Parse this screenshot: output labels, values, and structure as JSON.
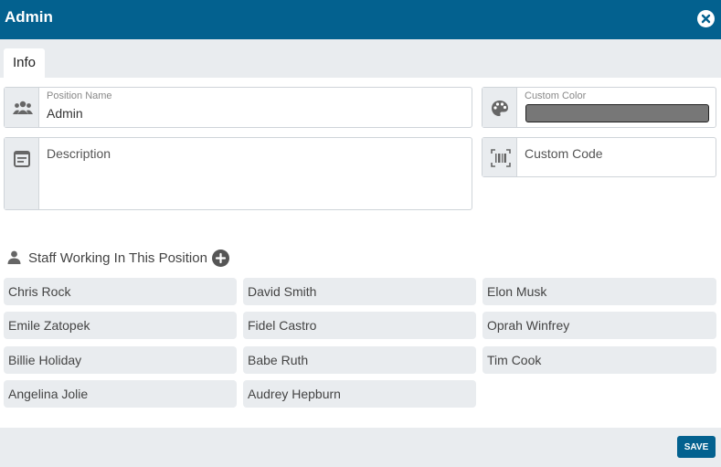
{
  "window": {
    "title": "Admin",
    "close_icon": "close-circle-icon"
  },
  "tabs": [
    {
      "label": "Info",
      "active": true
    }
  ],
  "form": {
    "position_name": {
      "label": "Position Name",
      "value": "Admin",
      "icon": "group-icon"
    },
    "custom_color": {
      "label": "Custom Color",
      "value_color": "#777777",
      "icon": "palette-icon"
    },
    "description": {
      "label": "Description",
      "value": "",
      "icon": "notes-icon"
    },
    "custom_code": {
      "label": "Custom Code",
      "value": "",
      "icon": "barcode-icon"
    }
  },
  "staff": {
    "heading": "Staff Working In This Position",
    "members": [
      "Chris Rock",
      "David Smith",
      "Elon Musk",
      "Emile Zatopek",
      "Fidel Castro",
      "Oprah Winfrey",
      "Billie Holiday",
      "Babe Ruth",
      "Tim Cook",
      "Angelina Jolie",
      "Audrey Hepburn"
    ]
  },
  "footer": {
    "save_label": "SAVE"
  },
  "colors": {
    "primary": "#03618f",
    "panel": "#e9ecef"
  }
}
